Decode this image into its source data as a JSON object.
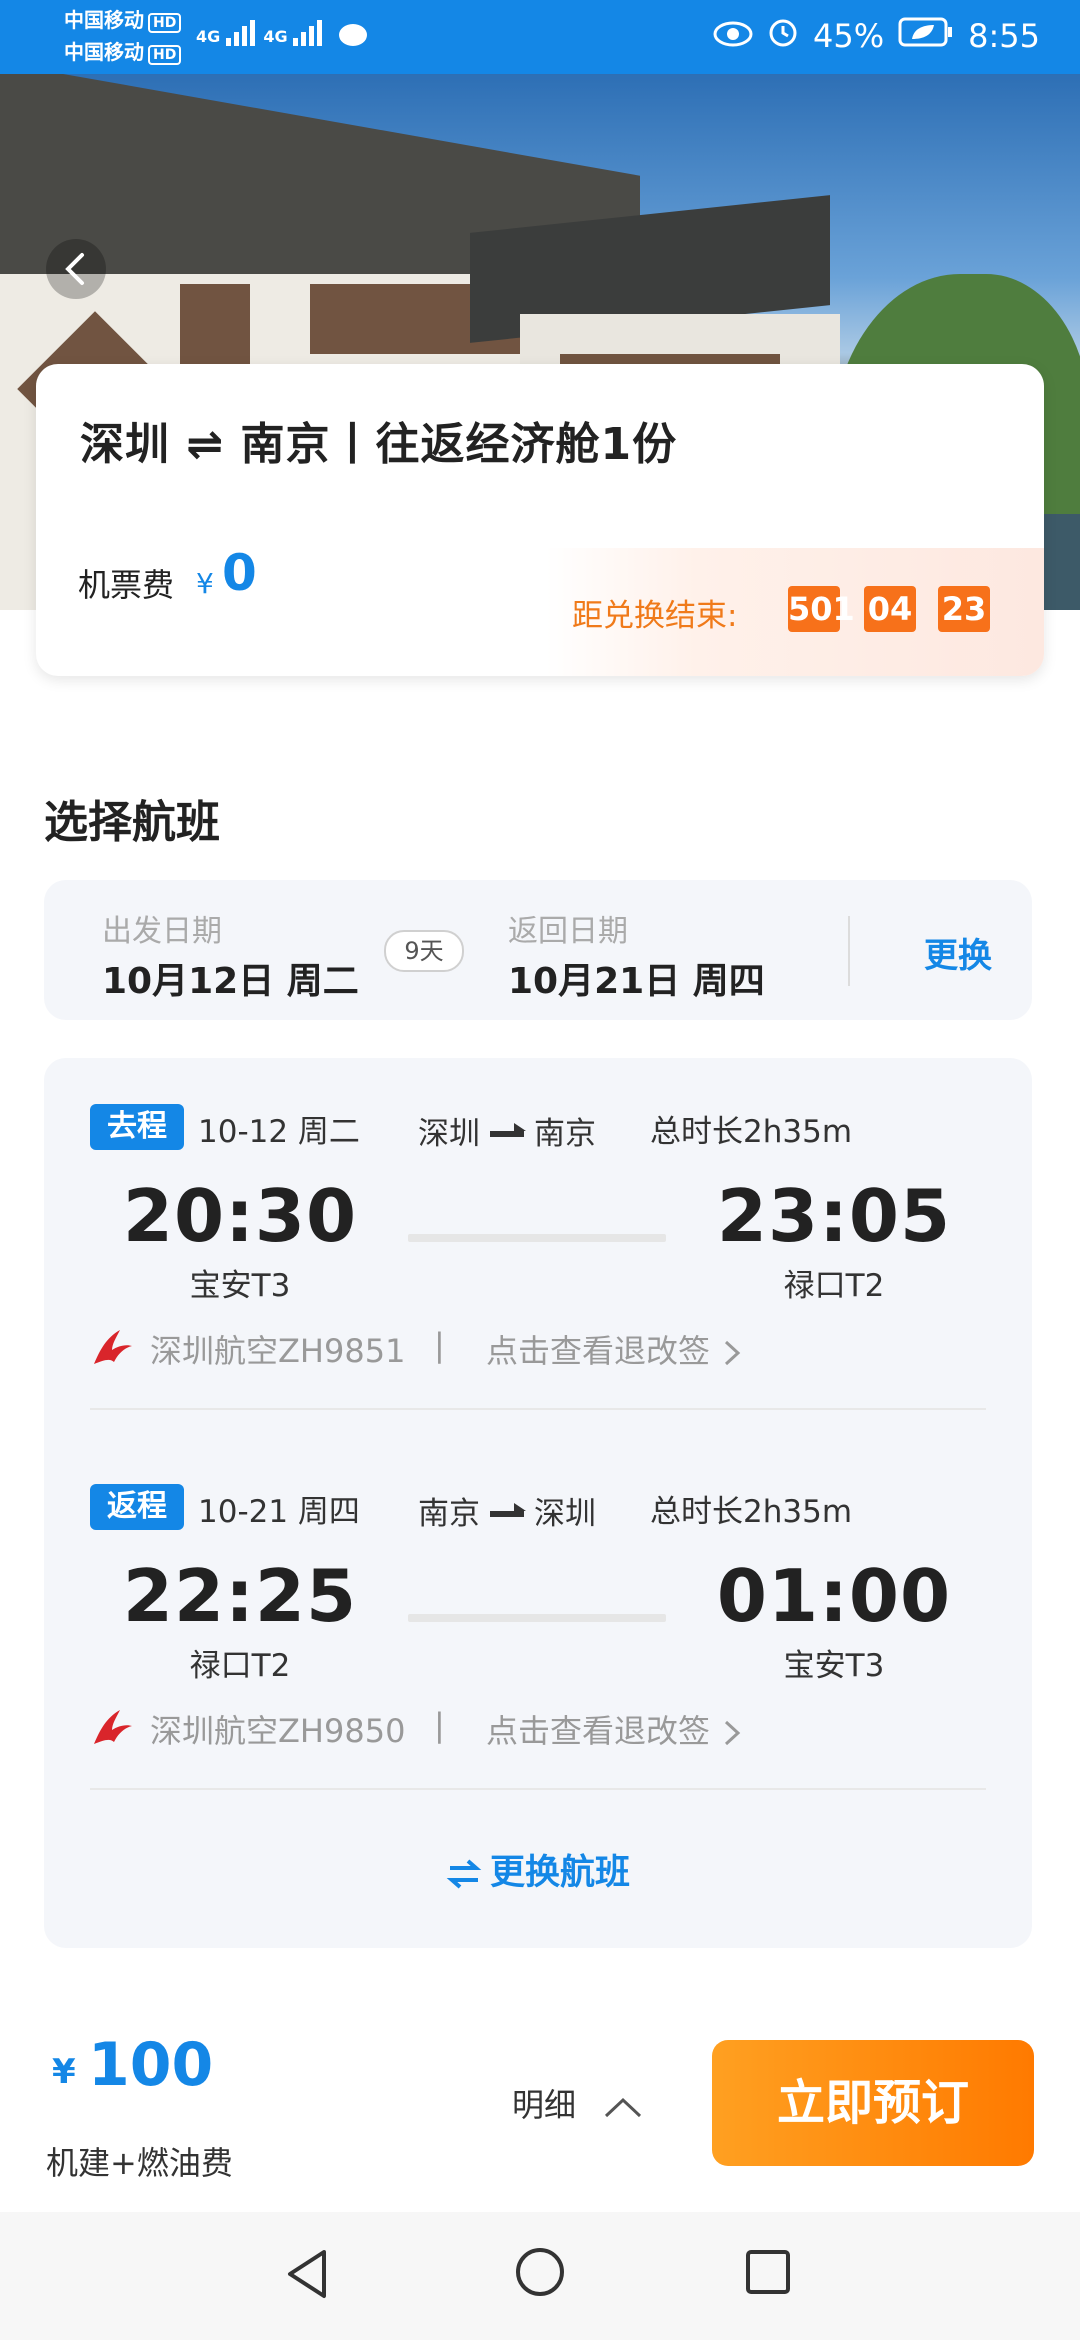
{
  "status_bar": {
    "carrier1": "中国移动",
    "carrier2": "中国移动",
    "hd": "HD",
    "network1": "4G",
    "network2": "4G",
    "battery": "45%",
    "time": "8:55"
  },
  "summary": {
    "title": "深圳 ⇌ 南京丨往返经济舱1份",
    "fee_label": "机票费",
    "fee_currency": "¥",
    "fee_value": "0",
    "countdown_label": "距兑换结束:",
    "countdown": [
      "501",
      "04",
      "23"
    ]
  },
  "section_title": "选择航班",
  "dates": {
    "depart_label": "出发日期",
    "depart_value": "10月12日 周二",
    "days": "9天",
    "return_label": "返回日期",
    "return_value": "10月21日 周四",
    "change": "更换"
  },
  "flights": [
    {
      "tag": "去程",
      "date": "10-12 周二",
      "from_city": "深圳",
      "to_city": "南京",
      "duration": "总时长2h35m",
      "dep_time": "20:30",
      "dep_terminal": "宝安T3",
      "arr_time": "23:05",
      "arr_terminal": "禄口T2",
      "airline": "深圳航空ZH9851",
      "separator": "|",
      "detail": "点击查看退改签"
    },
    {
      "tag": "返程",
      "date": "10-21 周四",
      "from_city": "南京",
      "to_city": "深圳",
      "duration": "总时长2h35m",
      "dep_time": "22:25",
      "dep_terminal": "禄口T2",
      "arr_time": "01:00",
      "arr_terminal": "宝安T3",
      "airline": "深圳航空ZH9850",
      "separator": "|",
      "detail": "点击查看退改签"
    }
  ],
  "change_flight": "更换航班",
  "bottom": {
    "currency": "¥",
    "price": "100",
    "price_note": "机建+燃油费",
    "detail": "明细",
    "book": "立即预订"
  },
  "colors": {
    "primary": "#1487e6",
    "accent_orange": "#f7711a",
    "button_gradient_start": "#ffa021",
    "button_gradient_end": "#ff7a00"
  },
  "icons": {
    "eye": "eye-icon",
    "alarm": "alarm-icon",
    "battery": "battery-icon",
    "back": "chevron-left-icon",
    "airline": "shenzhen-airlines-logo",
    "detail_chevron": "chevron-up-icon",
    "swap": "swap-arrows-icon"
  }
}
